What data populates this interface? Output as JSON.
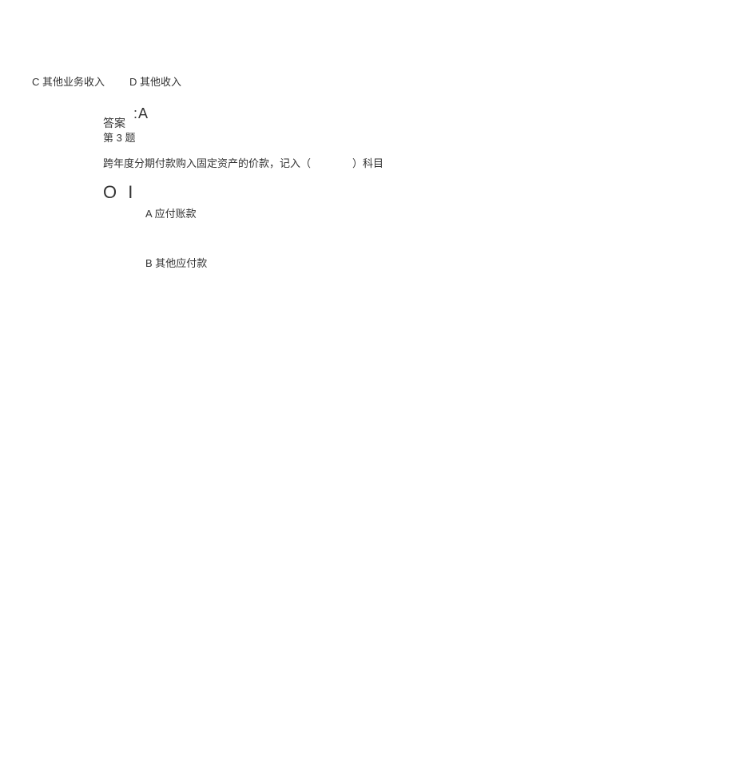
{
  "prev_options": {
    "c": "C 其他业务收入",
    "d": "D 其他收入"
  },
  "answer_label": "答案",
  "answer_value": ":A",
  "question_number": "第 3 题",
  "question_stem": "跨年度分期付款购入固定资产的价款，记入（　　　　）科目",
  "big_mark": "O I",
  "options": {
    "a": "A 应付账款",
    "b": "B 其他应付款"
  }
}
